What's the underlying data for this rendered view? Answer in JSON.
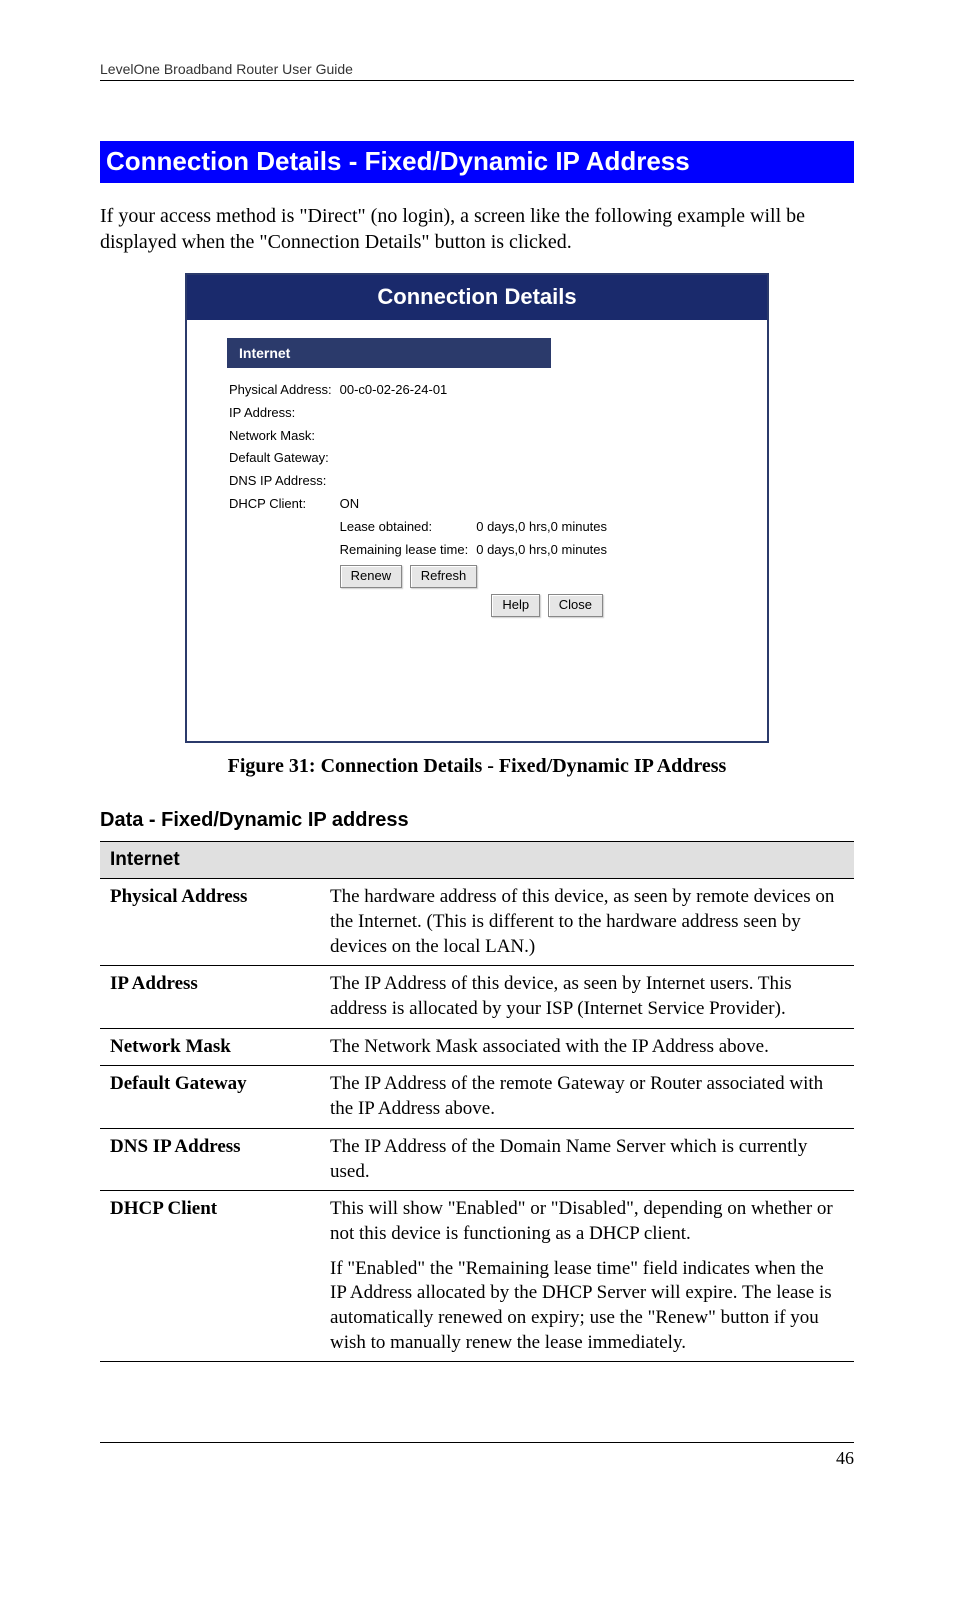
{
  "header": "LevelOne Broadband Router User Guide",
  "section_title": "Connection Details - Fixed/Dynamic IP Address",
  "intro": "If your access method is \"Direct\" (no login), a screen like the following example will be displayed when the \"Connection Details\" button is clicked.",
  "screenshot": {
    "title": "Connection Details",
    "section_label": "Internet",
    "rows": {
      "physical_address": {
        "label": "Physical Address:",
        "value": "00-c0-02-26-24-01"
      },
      "ip_address": {
        "label": "IP Address:",
        "value": ""
      },
      "network_mask": {
        "label": "Network Mask:",
        "value": ""
      },
      "default_gateway": {
        "label": "Default Gateway:",
        "value": ""
      },
      "dns_ip": {
        "label": "DNS IP Address:",
        "value": ""
      },
      "dhcp_client": {
        "label": "DHCP Client:",
        "value": "ON"
      },
      "lease_obtained": {
        "label": "Lease obtained:",
        "value": "0 days,0 hrs,0 minutes"
      },
      "remaining": {
        "label": "Remaining lease time:",
        "value": "0 days,0 hrs,0 minutes"
      }
    },
    "buttons": {
      "renew": "Renew",
      "refresh": "Refresh",
      "help": "Help",
      "close": "Close"
    }
  },
  "figure_caption": "Figure 31: Connection Details - Fixed/Dynamic IP Address",
  "subheading": "Data - Fixed/Dynamic IP address",
  "table": {
    "group_header": "Internet",
    "rows": [
      {
        "label": "Physical Address",
        "desc": [
          "The hardware address of this device, as seen by remote devices on the Internet. (This is different to the hardware address seen by devices on the local LAN.)"
        ]
      },
      {
        "label": "IP Address",
        "desc": [
          "The IP Address of this device, as seen by Internet users. This address is allocated by your ISP (Internet Service Provider)."
        ]
      },
      {
        "label": "Network Mask",
        "desc": [
          "The Network Mask associated with the IP Address above."
        ]
      },
      {
        "label": "Default Gateway",
        "desc": [
          "The IP Address of the remote Gateway or Router associated with the IP Address above."
        ]
      },
      {
        "label": "DNS IP Address",
        "desc": [
          "The IP Address of the Domain Name Server which is currently used."
        ]
      },
      {
        "label": "DHCP Client",
        "desc": [
          "This will show \"Enabled\" or \"Disabled\", depending on whether or not this device is functioning as a DHCP client.",
          "If \"Enabled\" the \"Remaining lease time\" field indicates when the IP Address allocated by the DHCP Server will expire. The lease is automatically renewed on expiry; use the \"Renew\" button if you wish to manually renew the lease immediately."
        ]
      }
    ]
  },
  "page_number": "46"
}
